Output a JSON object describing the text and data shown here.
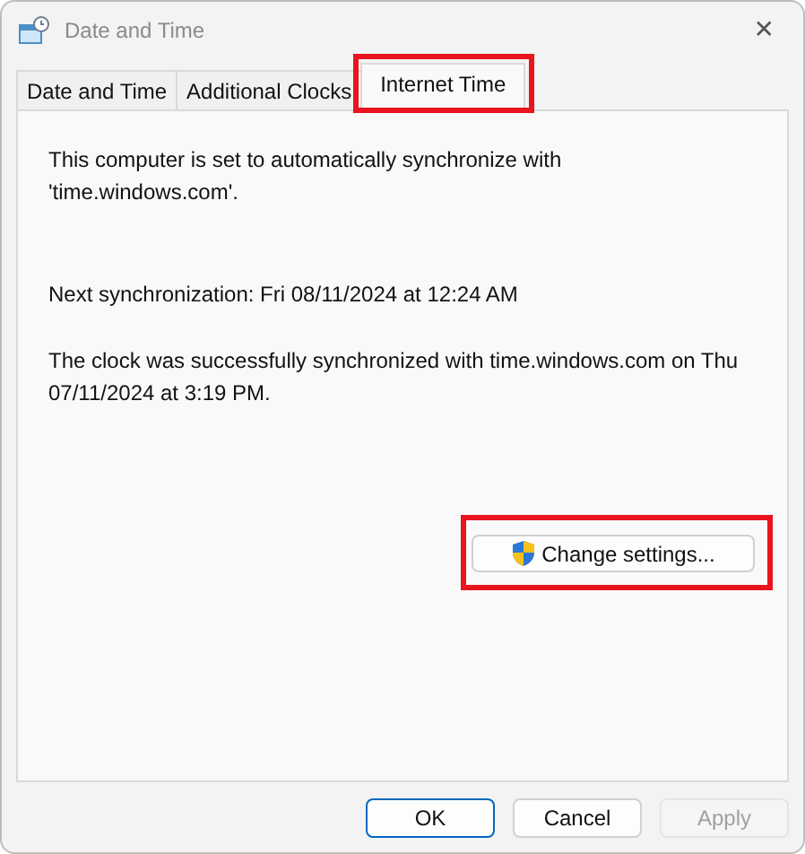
{
  "window": {
    "title": "Date and Time",
    "close": "✕"
  },
  "tabs": [
    {
      "label": "Date and Time",
      "selected": false,
      "highlighted": false
    },
    {
      "label": "Additional Clocks",
      "selected": false,
      "highlighted": false
    },
    {
      "label": "Internet Time",
      "selected": true,
      "highlighted": true
    }
  ],
  "messages": [
    "This computer is set to automatically synchronize with 'time.windows.com'.",
    "Next synchronization: Fri 08/11/2024 at 12:24 AM",
    "The clock was successfully synchronized with time.windows.com on Thu 07/11/2024 at 3:19 PM."
  ],
  "change_settings": {
    "label": "Change settings...",
    "highlighted": true
  },
  "buttons": [
    {
      "label": "OK",
      "default": true,
      "disabled": false
    },
    {
      "label": "Cancel",
      "default": false,
      "disabled": false
    },
    {
      "label": "Apply",
      "default": false,
      "disabled": true
    }
  ]
}
